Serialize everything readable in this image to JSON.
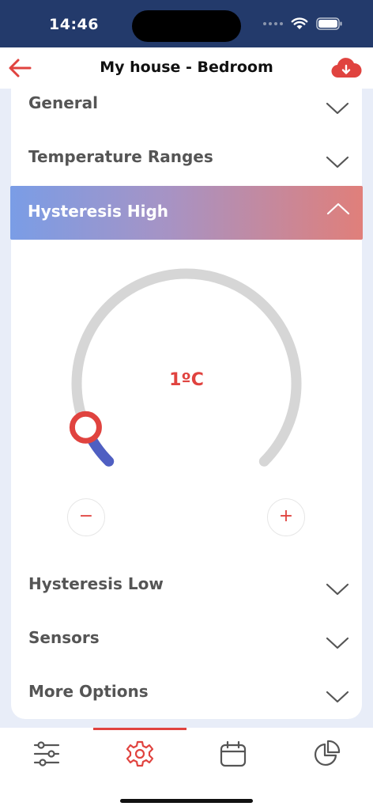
{
  "status_bar": {
    "time": "14:46"
  },
  "header": {
    "title": "My house - Bedroom"
  },
  "sections": {
    "general": "General",
    "temperature_ranges": "Temperature Ranges",
    "hysteresis_high": "Hysteresis High",
    "hysteresis_low": "Hysteresis Low",
    "sensors": "Sensors",
    "more_options": "More Options"
  },
  "dial": {
    "value_label": "1ºC",
    "level_fraction": 0.08,
    "minus_label": "−",
    "plus_label": "+"
  },
  "tabs": [
    "sliders",
    "settings",
    "calendar",
    "pie-chart"
  ],
  "active_tab": "settings",
  "colors": {
    "accent": "#e0433f",
    "status_bar": "#233a6b",
    "progress": "#4f5fc2",
    "track": "#d6d6d6",
    "gradient_start": "#7a9de6",
    "gradient_end": "#e07f7a"
  },
  "icons": {
    "back": "arrow-left-icon",
    "cloud": "cloud-download-icon",
    "chevron": "chevron-down-icon"
  }
}
